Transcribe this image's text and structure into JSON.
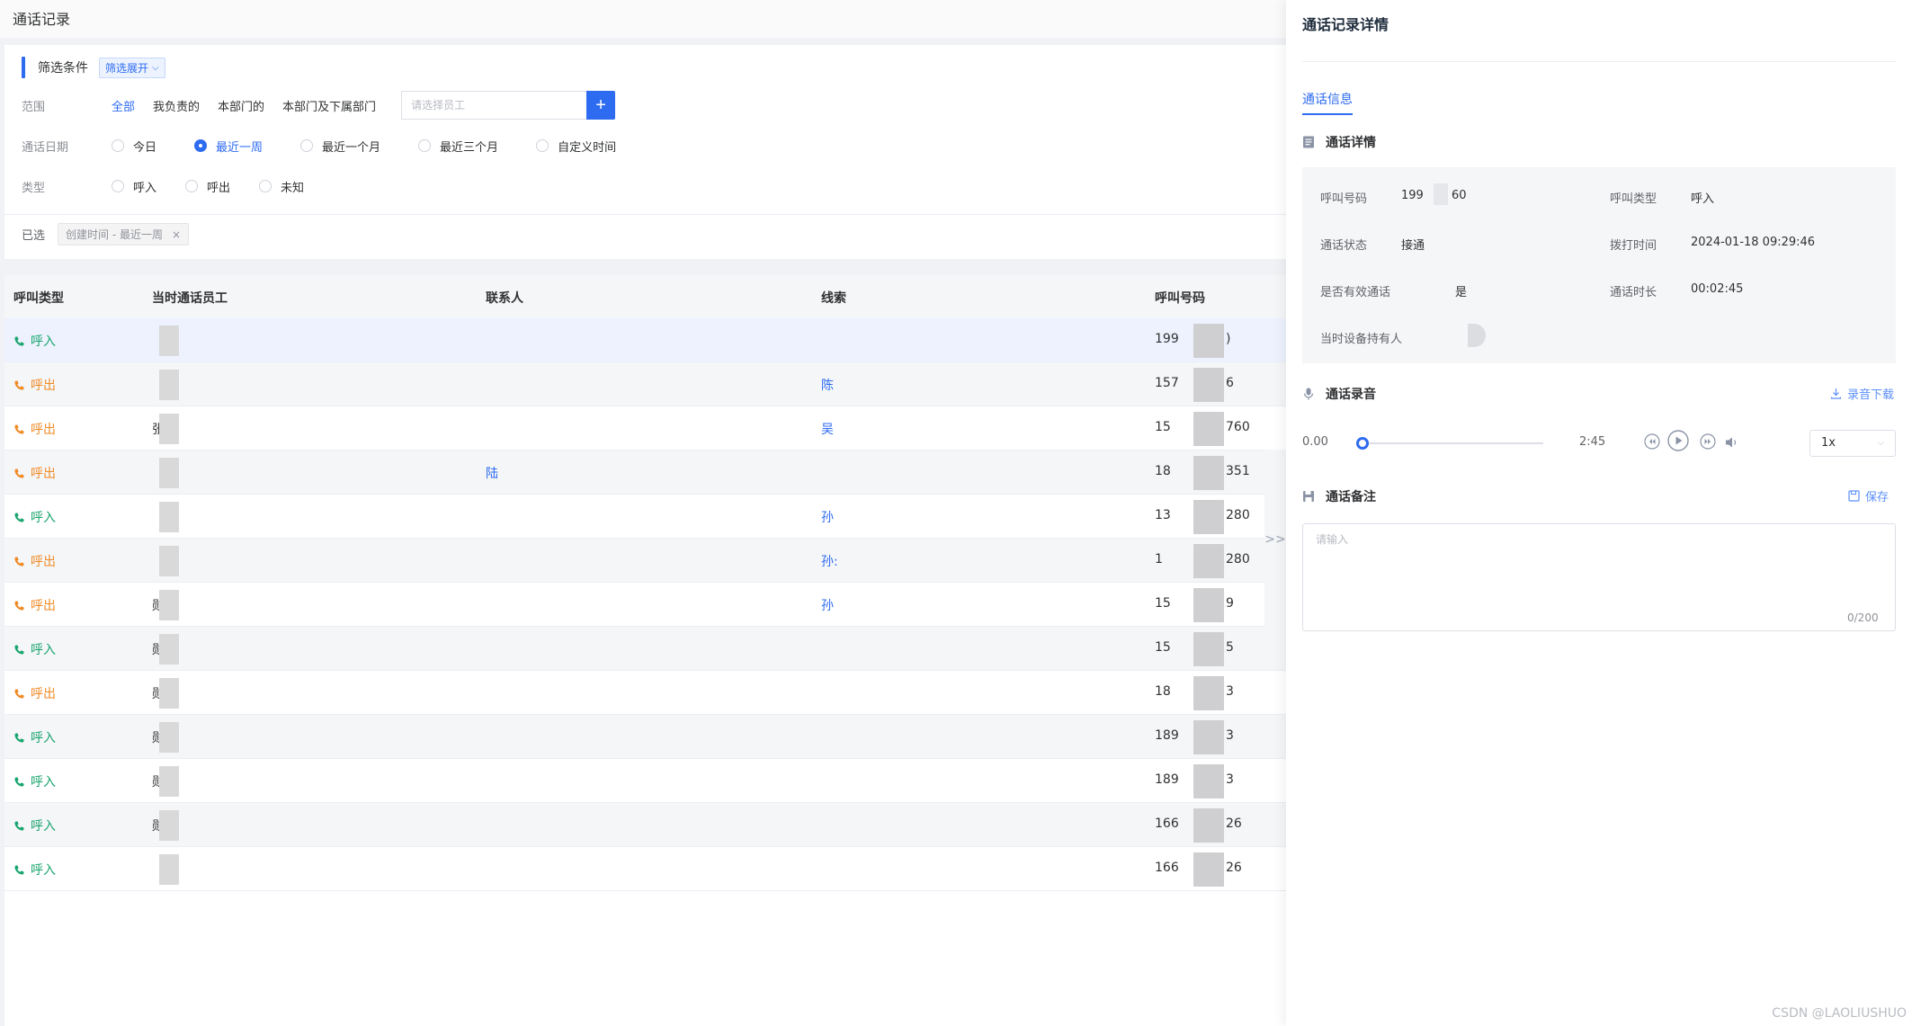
{
  "page": {
    "title": "通话记录"
  },
  "filter": {
    "title": "筛选条件",
    "expand_label": "筛选展开",
    "scope": {
      "label": "范围",
      "options": [
        "全部",
        "我负责的",
        "本部门的",
        "本部门及下属部门"
      ],
      "active": 0,
      "employee_placeholder": "请选择员工",
      "add_label": "+"
    },
    "date": {
      "label": "通话日期",
      "options": [
        "今日",
        "最近一周",
        "最近一个月",
        "最近三个月",
        "自定义时间"
      ],
      "selected": 1
    },
    "type": {
      "label": "类型",
      "options": [
        "呼入",
        "呼出",
        "未知"
      ]
    },
    "selected": {
      "label": "已选",
      "tag": "创建时间 - 最近一周",
      "tag_close": "×"
    }
  },
  "table": {
    "columns": [
      "呼叫类型",
      "当时通话员工",
      "联系人",
      "线索",
      "呼叫号码"
    ],
    "rows": [
      {
        "type": "呼入",
        "dir": "in",
        "staff": "",
        "contact": "",
        "lead": "",
        "number": "199"
      },
      {
        "type": "呼出",
        "dir": "out",
        "staff": "",
        "contact": "",
        "lead": "陈",
        "number": "157"
      },
      {
        "type": "呼出",
        "dir": "out",
        "staff": "张",
        "contact": "",
        "lead": "吴",
        "number": "15"
      },
      {
        "type": "呼出",
        "dir": "out",
        "staff": "",
        "contact": "陆",
        "lead": "",
        "number": "18"
      },
      {
        "type": "呼入",
        "dir": "in",
        "staff": "",
        "contact": "",
        "lead": "孙",
        "number": "13"
      },
      {
        "type": "呼出",
        "dir": "out",
        "staff": "",
        "contact": "",
        "lead": "孙:",
        "number": "1"
      },
      {
        "type": "呼出",
        "dir": "out",
        "staff": "勋",
        "contact": "",
        "lead": "孙",
        "number": "15"
      },
      {
        "type": "呼入",
        "dir": "in",
        "staff": "勋",
        "contact": "",
        "lead": "",
        "number": "15"
      },
      {
        "type": "呼出",
        "dir": "out",
        "staff": "勋",
        "contact": "",
        "lead": "",
        "number": "18"
      },
      {
        "type": "呼入",
        "dir": "in",
        "staff": "勋",
        "contact": "",
        "lead": "",
        "number": "189"
      },
      {
        "type": "呼入",
        "dir": "in",
        "staff": "勋",
        "contact": "",
        "lead": "",
        "number": "189"
      },
      {
        "type": "呼入",
        "dir": "in",
        "staff": "勋",
        "contact": "",
        "lead": "",
        "number": "166"
      },
      {
        "type": "呼入",
        "dir": "in",
        "staff": "",
        "contact": "",
        "lead": "",
        "number": "166"
      }
    ],
    "number_tails": [
      ")",
      "6",
      "760",
      "351",
      "280",
      "280",
      "9",
      "5",
      "3",
      "3",
      "3",
      "26",
      "26"
    ],
    "expand_handle": ">>"
  },
  "drawer": {
    "title": "通话记录详情",
    "tab": "通话信息",
    "detail_title": "通话详情",
    "fields": {
      "caller_label": "呼叫号码",
      "caller_value": "199",
      "caller_tail": "60",
      "type_label": "呼叫类型",
      "type_value": "呼入",
      "status_label": "通话状态",
      "status_value": "接通",
      "dial_label": "拨打时间",
      "dial_value": "2024-01-18 09:29:46",
      "valid_label": "是否有效通话",
      "valid_value": "是",
      "duration_label": "通话时长",
      "duration_value": "00:02:45",
      "holder_label": "当时设备持有人"
    },
    "recording_title": "通话录音",
    "download_label": "录音下载",
    "player": {
      "current": "0.00",
      "total": "2:45",
      "speed": "1x",
      "progress": 0
    },
    "remark_title": "通话备注",
    "save_label": "保存",
    "remark_placeholder": "请输入",
    "remark_count": "0/200"
  },
  "watermark": "CSDN @LAOLIUSHUO",
  "colors": {
    "accent": "#2d6bf0",
    "inbound": "#1aa56f",
    "outbound": "#f08a24"
  }
}
